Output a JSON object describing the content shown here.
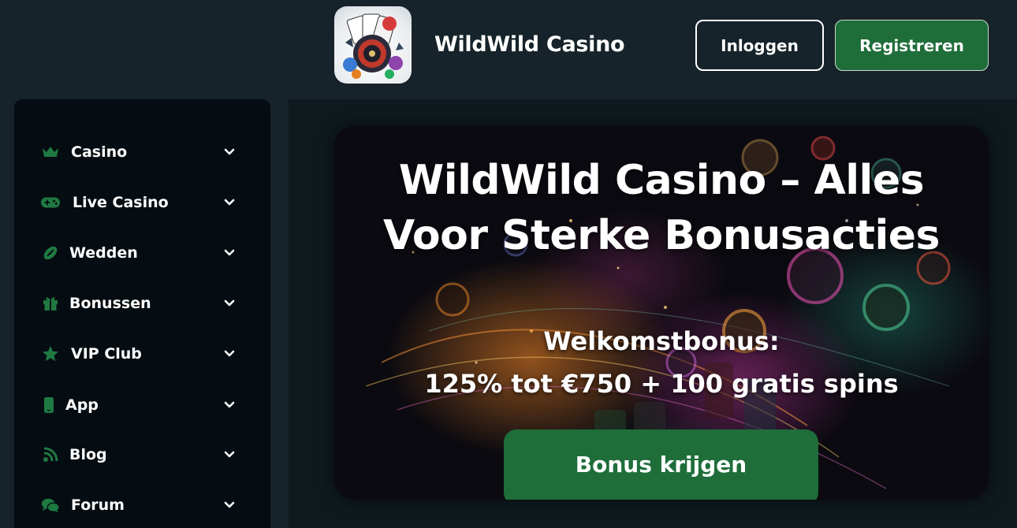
{
  "header": {
    "logo_alt": "WildWild Casino logo",
    "brand": "WildWild Casino",
    "login_label": "Inloggen",
    "register_label": "Registreren"
  },
  "sidebar": {
    "items": [
      {
        "label": "Casino",
        "icon": "crown-icon"
      },
      {
        "label": "Live Casino",
        "icon": "gamepad-icon"
      },
      {
        "label": "Wedden",
        "icon": "football-icon"
      },
      {
        "label": "Bonussen",
        "icon": "gift-icon"
      },
      {
        "label": "VIP Club",
        "icon": "star-icon"
      },
      {
        "label": "App",
        "icon": "phone-icon"
      },
      {
        "label": "Blog",
        "icon": "blog-icon"
      },
      {
        "label": "Forum",
        "icon": "chat-icon"
      }
    ]
  },
  "hero": {
    "title_line1": "WildWild Casino – Alles",
    "title_line2": "Voor Sterke Bonusacties",
    "bonus_heading": "Welkomstbonus:",
    "bonus_offer": "125% tot €750 + 100 gratis spins",
    "cta_label": "Bonus krijgen"
  },
  "colors": {
    "page_bg": "#16232a",
    "sidebar_bg": "#050d12",
    "accent_green": "#1f6e3a",
    "icon_green": "#1f7a42"
  }
}
